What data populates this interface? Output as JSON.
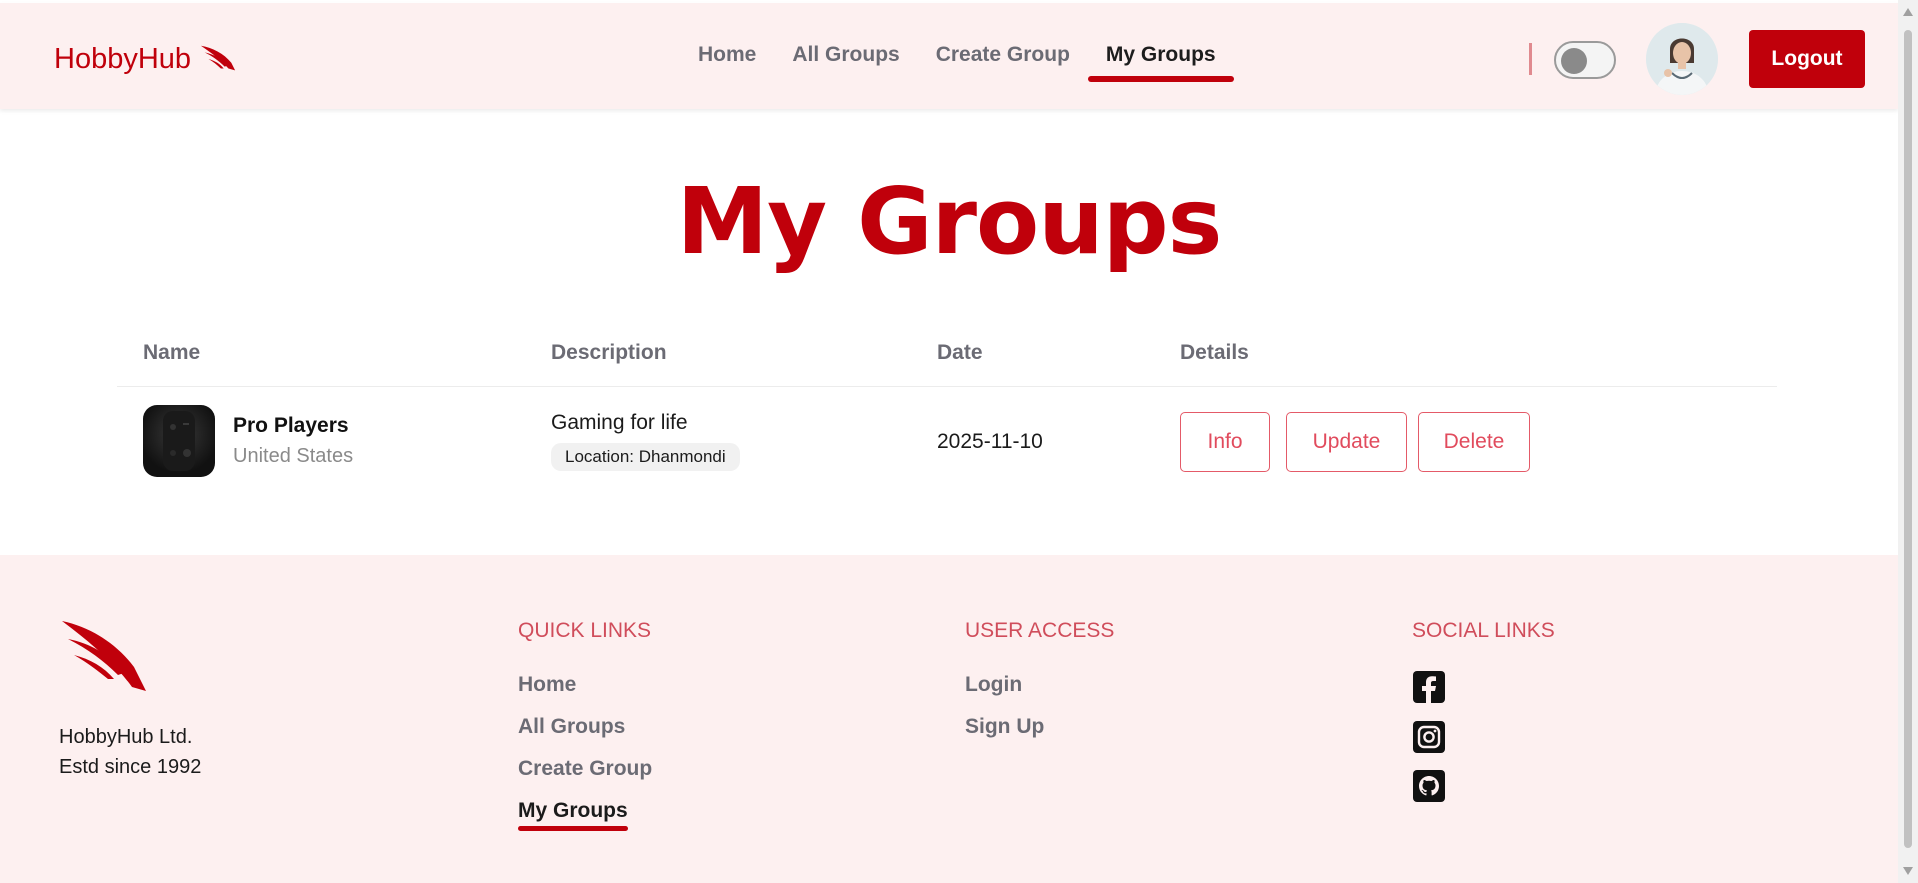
{
  "navbar": {
    "brand": "HobbyHub",
    "links": [
      {
        "label": "Home"
      },
      {
        "label": "All Groups"
      },
      {
        "label": "Create Group"
      },
      {
        "label": "My Groups",
        "active": true
      }
    ],
    "logout_label": "Logout",
    "theme_toggle": "off"
  },
  "main": {
    "title": "My Groups",
    "columns": [
      "Name",
      "Description",
      "Date",
      "Details"
    ],
    "rows": [
      {
        "name": "Pro Players",
        "country": "United States",
        "description": "Gaming for life",
        "location": "Location: Dhanmondi",
        "date": "2025-11-10",
        "actions": [
          "Info",
          "Update",
          "Delete"
        ]
      }
    ]
  },
  "footer": {
    "company": "HobbyHub Ltd.",
    "estd": "Estd since 1992",
    "quick_links": {
      "title": "QUICK LINKS",
      "items": [
        "Home",
        "All Groups",
        "Create Group",
        "My Groups"
      ]
    },
    "user_access": {
      "title": "USER ACCESS",
      "items": [
        "Login",
        "Sign Up"
      ]
    },
    "social_links": {
      "title": "SOCIAL LINKS",
      "items": [
        "facebook-icon",
        "instagram-icon",
        "github-icon"
      ]
    }
  },
  "colors": {
    "brand": "#c0000b",
    "background_tint": "#fdf0f0",
    "button_outline": "#e45a68"
  }
}
